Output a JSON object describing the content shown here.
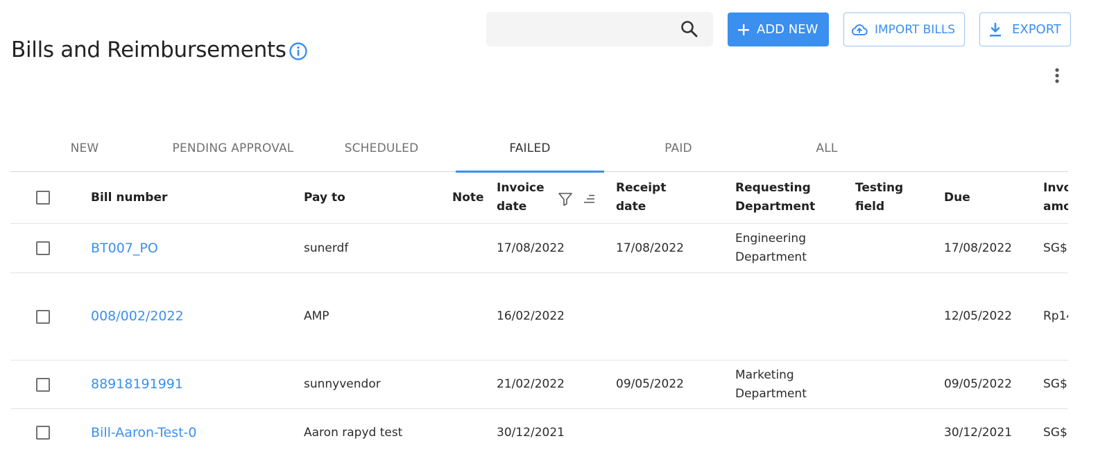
{
  "page": {
    "title": "Bills and Reimbursements"
  },
  "search": {
    "value": "",
    "placeholder": ""
  },
  "toolbar": {
    "add_label": "ADD NEW",
    "import_label": "IMPORT BILLS",
    "export_label": "EXPORT"
  },
  "tabs": [
    {
      "label": "NEW"
    },
    {
      "label": "PENDING APPROVAL"
    },
    {
      "label": "SCHEDULED"
    },
    {
      "label": "FAILED",
      "active": true
    },
    {
      "label": "PAID"
    },
    {
      "label": "ALL"
    }
  ],
  "table": {
    "columns": {
      "bill_number": "Bill number",
      "pay_to": "Pay to",
      "note": "Note",
      "invoice_date": "Invoice date",
      "receipt_date": "Receipt date",
      "requesting_department": "Requesting Department",
      "testing_field": "Testing field",
      "due": "Due",
      "invoice_amount": "Invoice amount"
    },
    "rows": [
      {
        "bill_number": "BT007_PO",
        "pay_to": "sunerdf",
        "note": "",
        "invoice_date": "17/08/2022",
        "receipt_date": "17/08/2022",
        "requesting_department": "Engineering Department",
        "testing_field": "",
        "due": "17/08/2022",
        "invoice_amount": "SG$"
      },
      {
        "bill_number": "008/002/2022",
        "pay_to": "AMP",
        "note": "",
        "invoice_date": "16/02/2022",
        "receipt_date": "",
        "requesting_department": "",
        "testing_field": "",
        "due": "12/05/2022",
        "invoice_amount": "Rp14"
      },
      {
        "bill_number": "88918191991",
        "pay_to": "sunnyvendor",
        "note": "",
        "invoice_date": "21/02/2022",
        "receipt_date": "09/05/2022",
        "requesting_department": "Marketing Department",
        "testing_field": "",
        "due": "09/05/2022",
        "invoice_amount": "SG$"
      },
      {
        "bill_number": "Bill-Aaron-Test-0",
        "pay_to": "Aaron rapyd test",
        "note": "",
        "invoice_date": "30/12/2021",
        "receipt_date": "",
        "requesting_department": "",
        "testing_field": "",
        "due": "30/12/2021",
        "invoice_amount": "SG$"
      }
    ]
  },
  "colors": {
    "accent": "#3a8fef",
    "divider": "#e2e2e2"
  },
  "icons": {
    "info": "info-circle-icon",
    "search": "search-icon",
    "add": "plus-icon",
    "import": "cloud-upload-icon",
    "export": "download-icon",
    "more": "kebab-menu-icon",
    "filter": "filter-icon",
    "sort": "sort-icon",
    "checkbox": "checkbox-icon"
  }
}
